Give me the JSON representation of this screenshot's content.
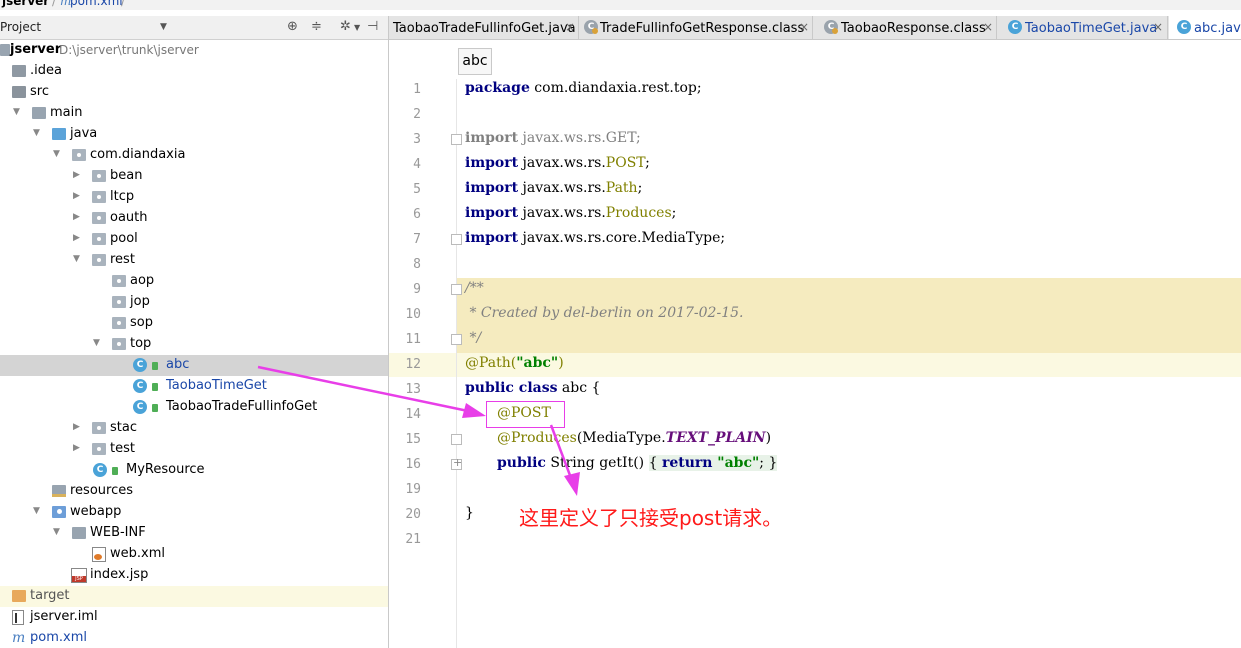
{
  "breadcrumb": {
    "project": "jserver",
    "sep": "/",
    "file_glyph": "m",
    "file": "pom.xml"
  },
  "project_panel": {
    "title": "Project",
    "tree": [
      {
        "label": "jserver",
        "path": "D:\\jserver\\trunk\\jserver",
        "bold": true,
        "icon": "folder-icon"
      },
      {
        "label": ".idea",
        "icon": "folder-icon"
      },
      {
        "label": "src",
        "icon": "folder-icon"
      },
      {
        "label": "main",
        "icon": "folder-icon"
      },
      {
        "label": "java",
        "icon": "source-folder-icon"
      },
      {
        "label": "com.diandaxia",
        "icon": "package-icon"
      },
      {
        "label": "bean",
        "icon": "package-icon"
      },
      {
        "label": "ltcp",
        "icon": "package-icon"
      },
      {
        "label": "oauth",
        "icon": "package-icon"
      },
      {
        "label": "pool",
        "icon": "package-icon"
      },
      {
        "label": "rest",
        "icon": "package-icon"
      },
      {
        "label": "aop",
        "icon": "package-icon"
      },
      {
        "label": "jop",
        "icon": "package-icon"
      },
      {
        "label": "sop",
        "icon": "package-icon"
      },
      {
        "label": "top",
        "icon": "package-icon"
      },
      {
        "label": "abc",
        "icon": "class-icon",
        "selected": true
      },
      {
        "label": "TaobaoTimeGet",
        "icon": "class-icon"
      },
      {
        "label": "TaobaoTradeFullinfoGet",
        "icon": "class-icon"
      },
      {
        "label": "stac",
        "icon": "package-icon"
      },
      {
        "label": "test",
        "icon": "package-icon"
      },
      {
        "label": "MyResource",
        "icon": "class-icon"
      },
      {
        "label": "resources",
        "icon": "resources-folder-icon"
      },
      {
        "label": "webapp",
        "icon": "web-folder-icon"
      },
      {
        "label": "WEB-INF",
        "icon": "folder-icon"
      },
      {
        "label": "web.xml",
        "icon": "xml-file-icon"
      },
      {
        "label": "index.jsp",
        "icon": "jsp-file-icon"
      },
      {
        "label": "target",
        "icon": "excluded-folder-icon",
        "highlighted": true
      },
      {
        "label": "jserver.iml",
        "icon": "iml-file-icon"
      },
      {
        "label": "pom.xml",
        "icon": "maven-file-icon"
      }
    ]
  },
  "tabs": [
    {
      "label": "TaobaoTradeFullinfoGet.java",
      "icon": "java-file-icon",
      "active": false
    },
    {
      "label": "TradeFullinfoGetResponse.class",
      "icon": "class-file-icon",
      "active": false
    },
    {
      "label": "TaobaoResponse.class",
      "icon": "class-file-icon",
      "active": false
    },
    {
      "label": "TaobaoTimeGet.java",
      "icon": "class-icon",
      "active": false
    },
    {
      "label": "abc.java",
      "icon": "class-icon",
      "active": true
    }
  ],
  "tab_close_glyph": "×",
  "editor": {
    "crumb": "abc",
    "line_numbers": [
      "1",
      "2",
      "3",
      "4",
      "5",
      "6",
      "7",
      "8",
      "9",
      "10",
      "11",
      "12",
      "13",
      "14",
      "15",
      "16",
      "19",
      "20",
      "21"
    ],
    "code": {
      "l1_kw": "package",
      "l1_rest": " com.diandaxia.rest.top;",
      "imp_kw": "import",
      "l3_rest": " javax.ws.rs.GET;",
      "l4_pre": " javax.ws.rs.",
      "l4_name": "POST",
      "l4_end": ";",
      "l5_pre": " javax.ws.rs.",
      "l5_name": "Path",
      "l5_end": ";",
      "l6_pre": " javax.ws.rs.",
      "l6_name": "Produces",
      "l6_end": ";",
      "l7_rest": " javax.ws.rs.core.MediaType;",
      "l9": "/**",
      "l10": " * Created by del-berlin on 2017-02-15.",
      "l11": " */",
      "l12_ann": "@Path(",
      "l12_str": "\"abc\"",
      "l12_end": ")",
      "l13_kw": "public class",
      "l13_rest": " abc {",
      "l14": "@POST",
      "l15_ann": "@Produces",
      "l15_mid": "(MediaType.",
      "l15_const": "TEXT_PLAIN",
      "l15_end": ")",
      "l16_kw1": "public",
      "l16_mid": " String getIt() ",
      "l16_open": "{ ",
      "l16_kw2": "return",
      "l16_str": " \"abc\"",
      "l16_close": "; }",
      "l20": "}"
    }
  },
  "annotation_note": "这里定义了只接受post请求。",
  "colors": {
    "annotation_magenta": "#e83ee8",
    "note_red": "#ff1a1a",
    "keyword_navy": "#000080",
    "string_green": "#008000",
    "annotation_olive": "#808000"
  }
}
